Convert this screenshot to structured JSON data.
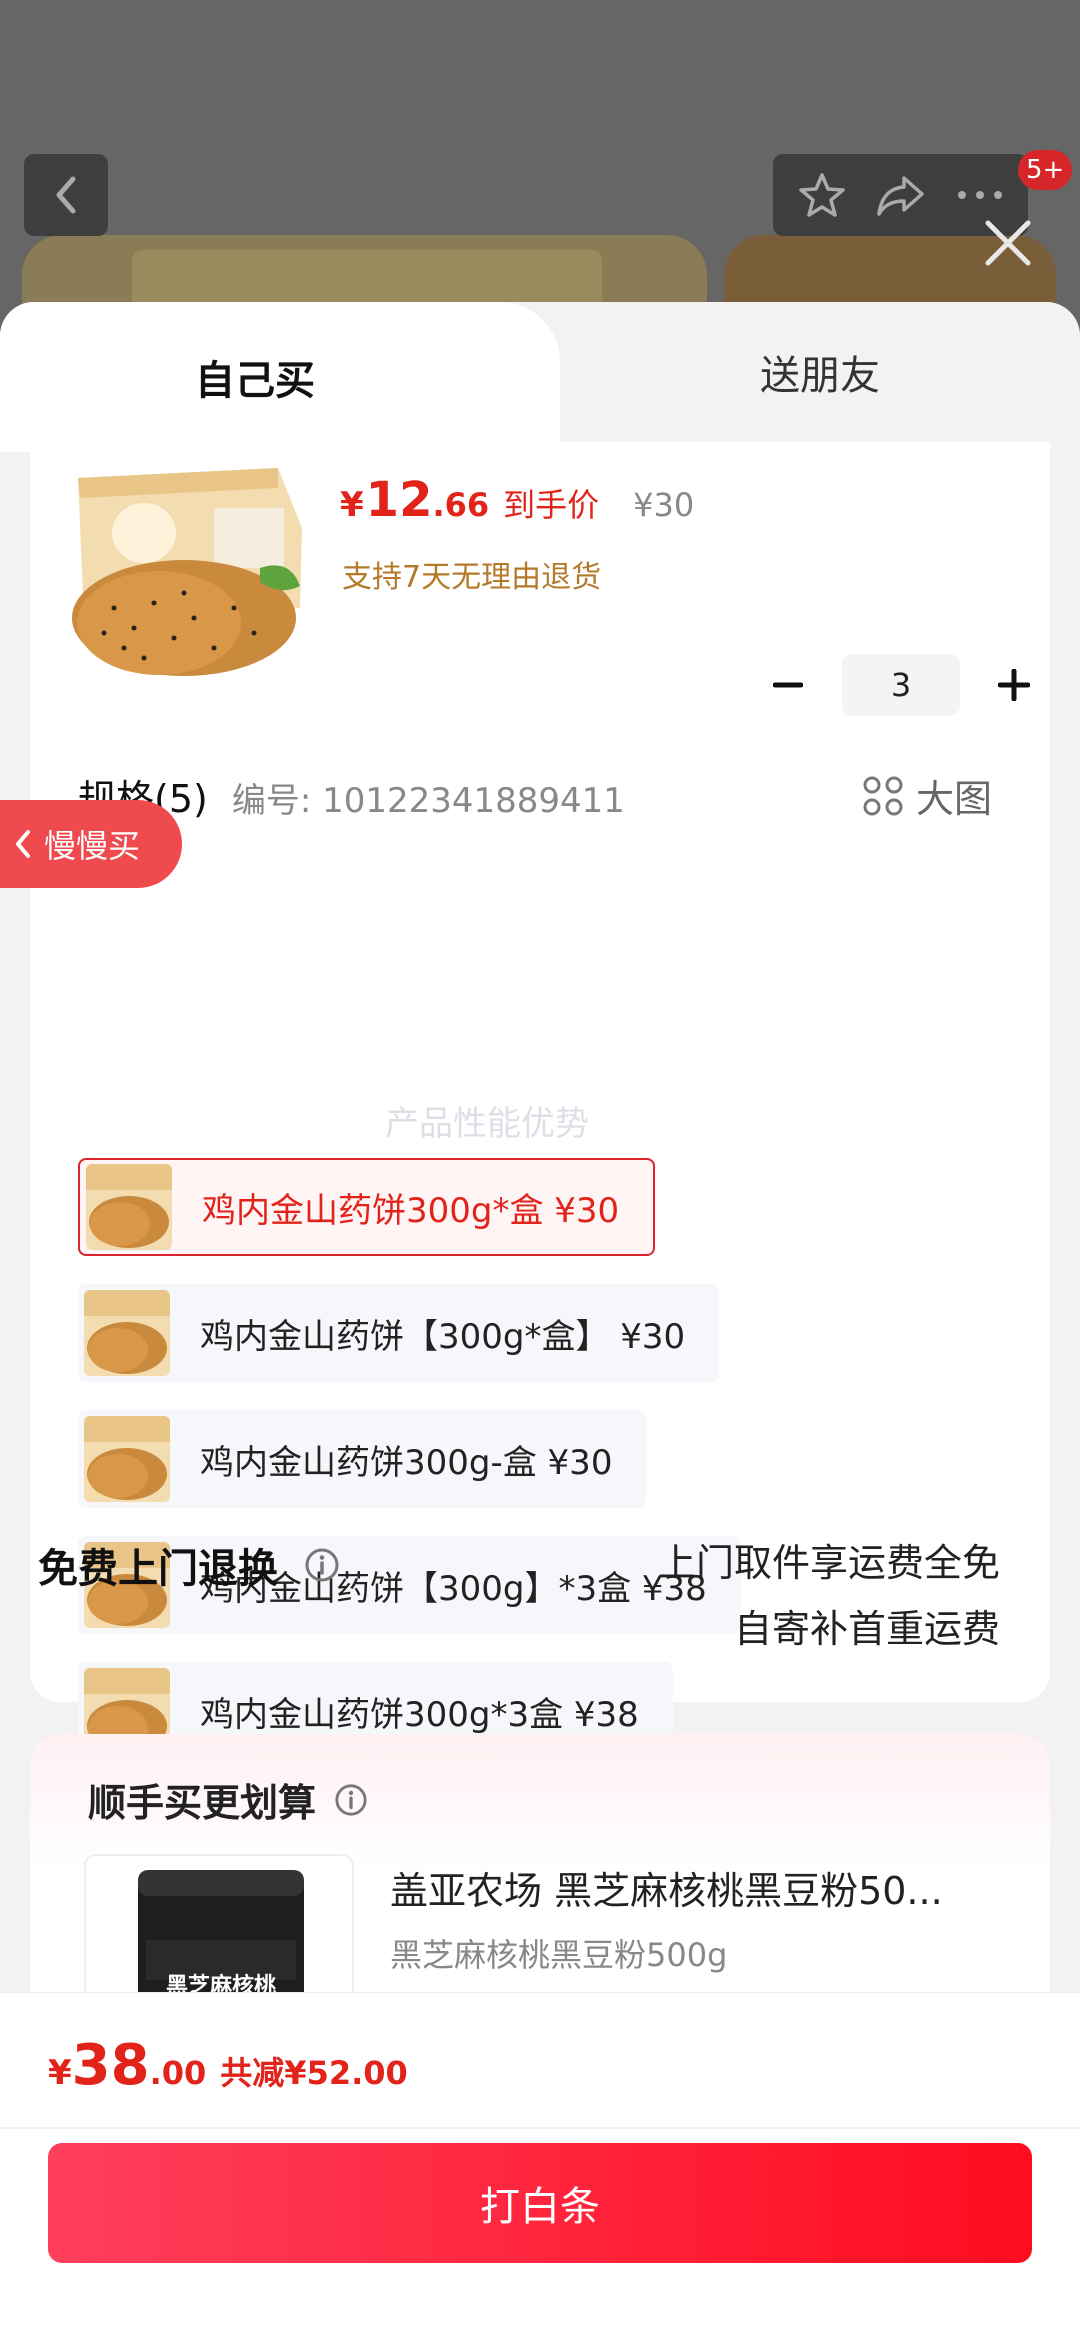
{
  "header": {
    "badge": "5+"
  },
  "tabs": [
    {
      "label": "自己买",
      "active": true
    },
    {
      "label": "送朋友",
      "active": false
    }
  ],
  "product": {
    "price_symbol": "¥",
    "price_int": "12",
    "price_dec": ".66",
    "price_label": "到手价",
    "original_price": "¥30",
    "return_note": "支持7天无理由退货",
    "quantity": "3"
  },
  "specs": {
    "title": "规格(5)",
    "code": "编号: 10122341889411",
    "big_image_label": "大图",
    "options": [
      {
        "label": "鸡内金山药饼300g*盒  ¥30",
        "selected": true
      },
      {
        "label": "鸡内金山药饼【300g*盒】  ¥30",
        "selected": false
      },
      {
        "label": "鸡内金山药饼300g-盒  ¥30",
        "selected": false
      },
      {
        "label": "鸡内金山药饼【300g】*3盒  ¥38",
        "selected": false
      },
      {
        "label": "鸡内金山药饼300g*3盒  ¥38",
        "selected": false
      }
    ]
  },
  "slow_buy": "慢慢买",
  "watermark": "产品性能优势",
  "free_return": {
    "title": "免费上门退换",
    "line1": "上门取件享运费全免",
    "line2": "自寄补首重运费"
  },
  "combo": {
    "title": "顺手买更划算",
    "name": "盖亚农场 黑芝麻核桃黑豆粉50...",
    "subtitle": "黑芝麻核桃黑豆粉500g",
    "jar_label": "黑芝麻核桃"
  },
  "footer": {
    "sym": "¥",
    "int": "38",
    "dec": ".00",
    "save": "共减¥52.00",
    "cta": "打白条"
  },
  "colors": {
    "accent": "#e2231a",
    "cta_start": "#ff3f5c",
    "cta_end": "#ff0c1f"
  }
}
